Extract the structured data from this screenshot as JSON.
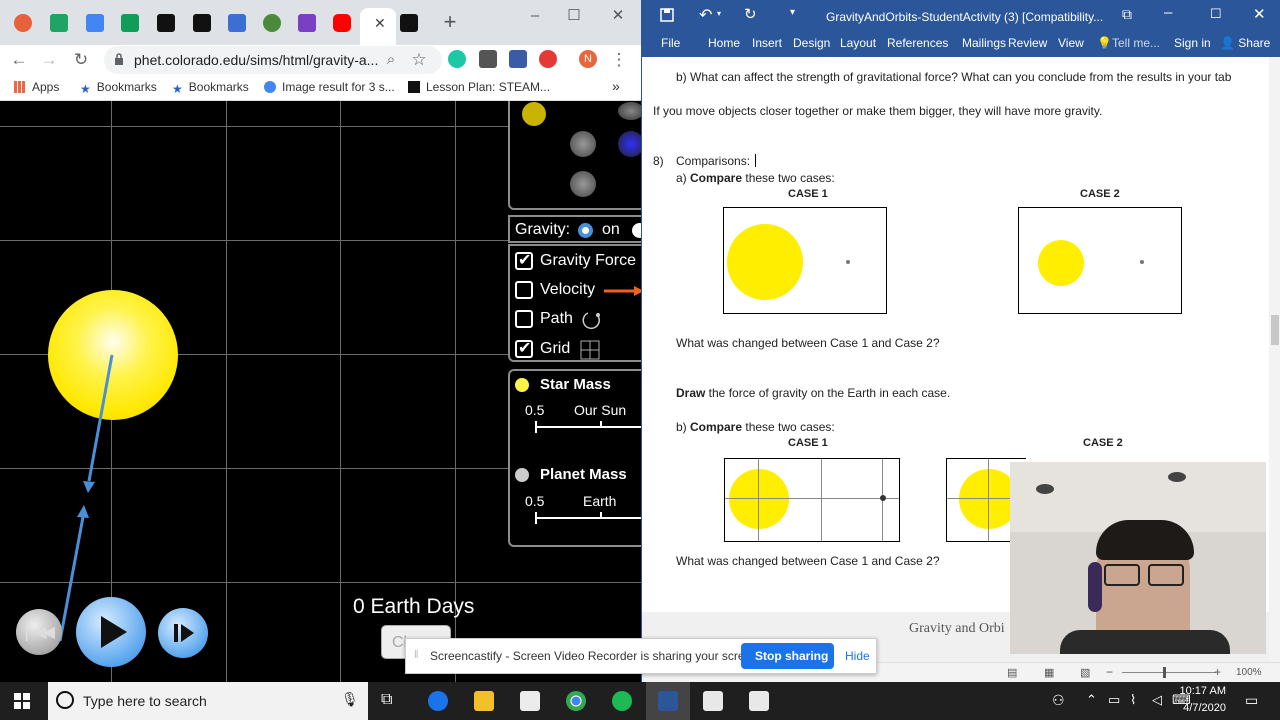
{
  "chrome": {
    "url": "phet.colorado.edu/sims/html/gravity-a...",
    "profile_initial": "N",
    "bookmarks": [
      "Apps",
      "Bookmarks",
      "Bookmarks",
      "Image result for 3 s...",
      "Lesson Plan: STEAM..."
    ],
    "bookmarks_more": "»"
  },
  "sim": {
    "gravity_label": "Gravity:",
    "gravity_on": "on",
    "checkboxes": [
      {
        "label": "Gravity Force",
        "checked": true
      },
      {
        "label": "Velocity",
        "checked": false
      },
      {
        "label": "Path",
        "checked": false
      },
      {
        "label": "Grid",
        "checked": true
      }
    ],
    "star_mass": {
      "label": "Star Mass",
      "min": "0.5",
      "value_label": "Our Sun"
    },
    "planet_mass": {
      "label": "Planet Mass",
      "min": "0.5",
      "value_label": "Earth"
    },
    "time": "0 Earth Days",
    "clear_button": "Cl"
  },
  "word": {
    "title": "GravityAndOrbits-StudentActivity (3) [Compatibility...",
    "ribbon_tabs": [
      "File",
      "Home",
      "Insert",
      "Design",
      "Layout",
      "References",
      "Mailings",
      "Review",
      "View",
      "Tell me...",
      "Sign in",
      "Share"
    ],
    "q7b": "b) What can affect the strength of gravitational force? What can you conclude from the results in your tab",
    "answer": "If you move objects closer together or make them bigger, they will have more gravity.",
    "q8_num": "8)",
    "q8_title": "Comparisons:",
    "q8a_pre": "a) ",
    "q8a_bold": "Compare",
    "q8a_post": " these two cases:",
    "case1": "CASE 1",
    "case2": "CASE 2",
    "what_changed": "What was changed between Case 1 and Case 2?",
    "draw_bold": "Draw",
    "draw_post": " the force of gravity on the Earth in each case.",
    "q8b_pre": "b) ",
    "q8b_bold": "Compare",
    "q8b_post": " these two cases:",
    "footer": "Gravity and Orbi",
    "zoom": "100%"
  },
  "castbar": {
    "message": "Screencastify - Screen Video Recorder is sharing your screen.",
    "stop": "Stop sharing",
    "hide": "Hide"
  },
  "taskbar": {
    "search_placeholder": "Type here to search",
    "time": "10:17 AM",
    "date": "4/7/2020"
  }
}
